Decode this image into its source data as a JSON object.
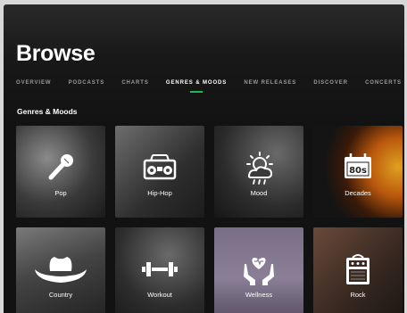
{
  "header": {
    "title": "Browse"
  },
  "nav": {
    "tabs": [
      {
        "label": "OVERVIEW",
        "active": false
      },
      {
        "label": "PODCASTS",
        "active": false
      },
      {
        "label": "CHARTS",
        "active": false
      },
      {
        "label": "GENRES & MOODS",
        "active": true
      },
      {
        "label": "NEW RELEASES",
        "active": false
      },
      {
        "label": "DISCOVER",
        "active": false
      },
      {
        "label": "CONCERTS",
        "active": false
      }
    ],
    "accent_color": "#1db954"
  },
  "section": {
    "title": "Genres & Moods",
    "tiles": [
      {
        "label": "Pop",
        "icon": "microphone-icon"
      },
      {
        "label": "Hip-Hop",
        "icon": "boombox-icon"
      },
      {
        "label": "Mood",
        "icon": "weather-icon"
      },
      {
        "label": "Decades",
        "icon": "eighties-icon",
        "icon_text": "80s"
      },
      {
        "label": "Country",
        "icon": "cowboy-hat-icon"
      },
      {
        "label": "Workout",
        "icon": "dumbbell-icon"
      },
      {
        "label": "Wellness",
        "icon": "heart-hands-icon"
      },
      {
        "label": "Rock",
        "icon": "amplifier-icon"
      }
    ]
  }
}
